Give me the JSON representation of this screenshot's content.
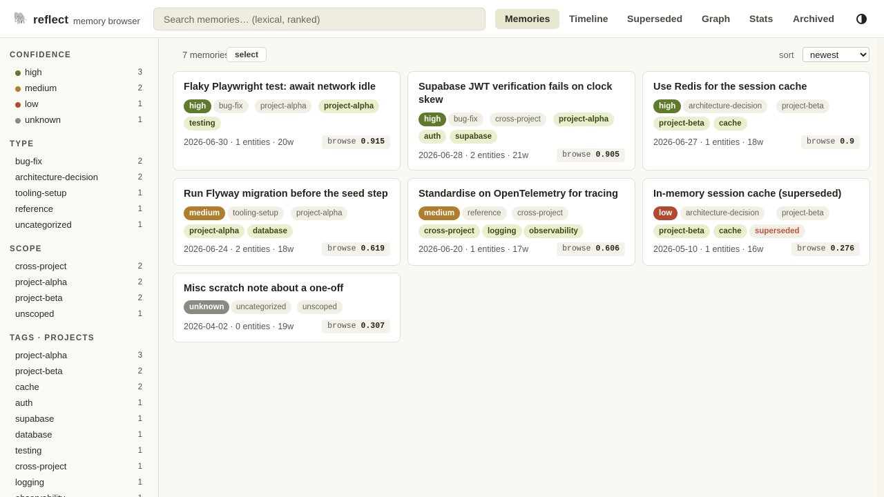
{
  "app": {
    "brand": "reflect",
    "subtitle": "memory browser",
    "logo_icon": "elephant-icon"
  },
  "search": {
    "placeholder": "Search memories… (lexical, ranked)",
    "value": ""
  },
  "nav": [
    "Memories",
    "Timeline",
    "Superseded",
    "Graph",
    "Stats",
    "Archived"
  ],
  "nav_active": "Memories",
  "theme_toggle_icon": "contrast-icon",
  "sidebar": {
    "confidence": {
      "title": "CONFIDENCE",
      "items": [
        {
          "label": "high",
          "count": "3",
          "color": "#5e7a2a"
        },
        {
          "label": "medium",
          "count": "2",
          "color": "#b07d2c"
        },
        {
          "label": "low",
          "count": "1",
          "color": "#b24a2f"
        },
        {
          "label": "unknown",
          "count": "1",
          "color": "#8a8a80"
        }
      ]
    },
    "type": {
      "title": "TYPE",
      "items": [
        {
          "label": "bug-fix",
          "count": "2"
        },
        {
          "label": "architecture-decision",
          "count": "2"
        },
        {
          "label": "tooling-setup",
          "count": "1"
        },
        {
          "label": "reference",
          "count": "1"
        },
        {
          "label": "uncategorized",
          "count": "1"
        }
      ]
    },
    "scope": {
      "title": "SCOPE",
      "items": [
        {
          "label": "cross-project",
          "count": "2"
        },
        {
          "label": "project-alpha",
          "count": "2"
        },
        {
          "label": "project-beta",
          "count": "2"
        },
        {
          "label": "unscoped",
          "count": "1"
        }
      ]
    },
    "tags": {
      "title": "TAGS · PROJECTS",
      "items": [
        {
          "label": "project-alpha",
          "count": "3"
        },
        {
          "label": "project-beta",
          "count": "2"
        },
        {
          "label": "cache",
          "count": "2"
        },
        {
          "label": "auth",
          "count": "1"
        },
        {
          "label": "supabase",
          "count": "1"
        },
        {
          "label": "database",
          "count": "1"
        },
        {
          "label": "testing",
          "count": "1"
        },
        {
          "label": "cross-project",
          "count": "1"
        },
        {
          "label": "logging",
          "count": "1"
        },
        {
          "label": "observability",
          "count": "1"
        }
      ]
    }
  },
  "main": {
    "count_text": "7 memories",
    "select_label": "select",
    "sort_label": "sort",
    "sort_value": "newest",
    "cards": [
      {
        "title": "Flaky Playwright test: await network idle",
        "confidence": "high",
        "type": "bug-fix",
        "scope": "project-alpha",
        "tags": [
          "project-alpha",
          "testing"
        ],
        "meta": "2026-06-30 · 1 entities · 20w",
        "browse_label": "browse",
        "browse_score": "0.915"
      },
      {
        "title": "Supabase JWT verification fails on clock skew",
        "confidence": "high",
        "type": "bug-fix",
        "scope": "cross-project",
        "tags": [
          "project-alpha",
          "auth",
          "supabase"
        ],
        "meta": "2026-06-28 · 2 entities · 21w",
        "browse_label": "browse",
        "browse_score": "0.905"
      },
      {
        "title": "Use Redis for the session cache",
        "confidence": "high",
        "type": "architecture-decision",
        "scope": "project-beta",
        "tags": [
          "project-beta",
          "cache"
        ],
        "meta": "2026-06-27 · 1 entities · 18w",
        "browse_label": "browse",
        "browse_score": "0.9"
      },
      {
        "title": "Run Flyway migration before the seed step",
        "confidence": "medium",
        "type": "tooling-setup",
        "scope": "project-alpha",
        "tags": [
          "project-alpha",
          "database"
        ],
        "meta": "2026-06-24 · 2 entities · 18w",
        "browse_label": "browse",
        "browse_score": "0.619"
      },
      {
        "title": "Standardise on OpenTelemetry for tracing",
        "confidence": "medium",
        "type": "reference",
        "scope": "cross-project",
        "tags": [
          "cross-project",
          "logging",
          "observability"
        ],
        "meta": "2026-06-20 · 1 entities · 17w",
        "browse_label": "browse",
        "browse_score": "0.606"
      },
      {
        "title": "In-memory session cache (superseded)",
        "confidence": "low",
        "type": "architecture-decision",
        "scope": "project-beta",
        "tags": [
          "project-beta",
          "cache"
        ],
        "status": "superseded",
        "meta": "2026-05-10 · 1 entities · 16w",
        "browse_label": "browse",
        "browse_score": "0.276"
      },
      {
        "title": "Misc scratch note about a one-off",
        "confidence": "unknown",
        "type": "uncategorized",
        "scope": "unscoped",
        "tags": [],
        "meta": "2026-04-02 · 0 entities · 19w",
        "browse_label": "browse",
        "browse_score": "0.307"
      }
    ]
  }
}
